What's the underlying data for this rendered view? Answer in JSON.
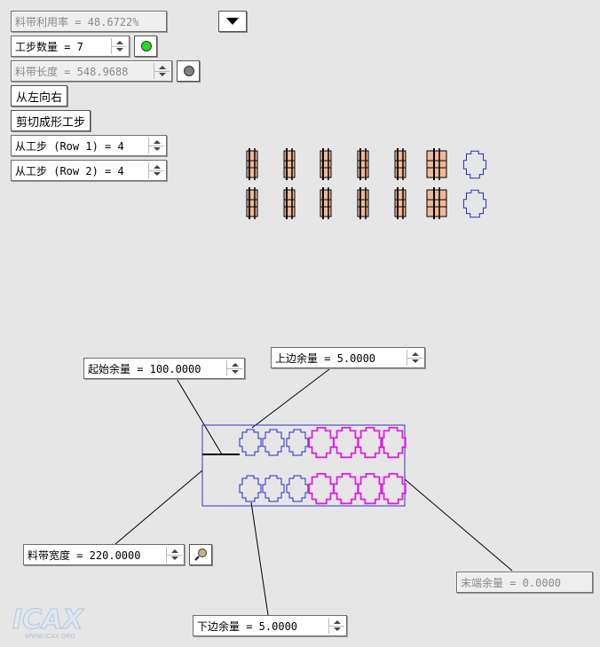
{
  "fields": {
    "utilization": "料带利用率 = 48.6722%",
    "step_count": "工步数量 = 7",
    "strip_length": "料带长度 = 548.9688",
    "row1_step": "从工步 (Row 1) = 4",
    "row2_step": "从工步 (Row 2) = 4",
    "start_margin": "起始余量 = 100.0000",
    "top_margin": "上边余量 =  5.0000",
    "strip_width": "料带宽度 = 220.0000",
    "end_margin": "末端余量 =  0.0000",
    "bottom_margin": "下边余量 =  5.0000"
  },
  "buttons": {
    "direction": "从左向右",
    "cut_forming": "剪切成形工步"
  },
  "status": {
    "step_indicator_color": "#22dd22",
    "length_indicator_color": "#808080"
  },
  "icons": {
    "dropdown": "triangle-down-icon",
    "wrench": "wrench-icon",
    "logo": "icax-logo"
  },
  "logo": {
    "text": "ICAX",
    "url_text": "WWW.ICAX.ORG"
  },
  "colors": {
    "part_outline": "#2a2acc",
    "part_formed": "#e020e0",
    "strip_border": "#3333cc",
    "step_fill": "#f0b898"
  }
}
